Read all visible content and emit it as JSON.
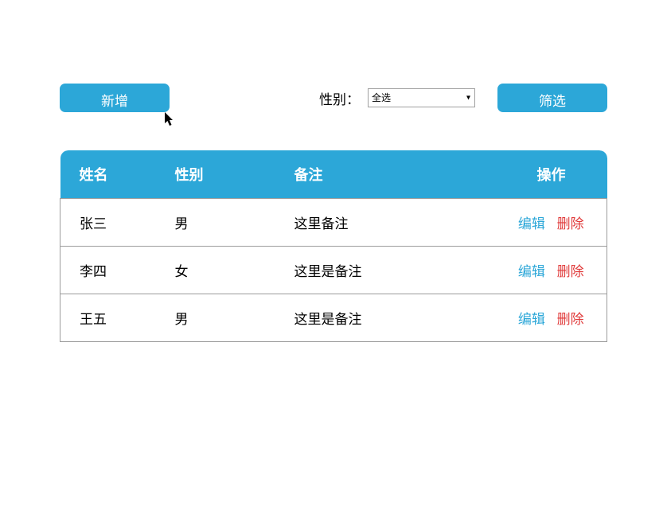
{
  "toolbar": {
    "add_label": "新增",
    "filter_label": "筛选",
    "gender_label": "性别：",
    "gender_selected": "全选"
  },
  "table": {
    "headers": {
      "name": "姓名",
      "gender": "性别",
      "remark": "备注",
      "action": "操作"
    },
    "actions": {
      "edit": "编辑",
      "delete": "删除"
    },
    "rows": [
      {
        "name": "张三",
        "gender": "男",
        "remark": "这里备注"
      },
      {
        "name": "李四",
        "gender": "女",
        "remark": "这里是备注"
      },
      {
        "name": "王五",
        "gender": "男",
        "remark": "这里是备注"
      }
    ]
  }
}
